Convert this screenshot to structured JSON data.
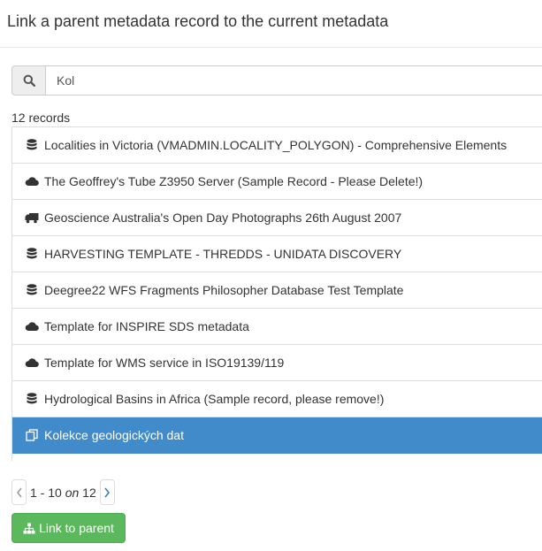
{
  "dialog": {
    "title": "Link a parent metadata record to the current metadata"
  },
  "search": {
    "value": "Kol",
    "icon": "search-icon"
  },
  "results": {
    "count_label": "12 records",
    "items": [
      {
        "label": "Localities in Victoria (VMADMIN.LOCALITY_POLYGON) - Comprehensive Elements",
        "icon": "database-icon"
      },
      {
        "label": "The Geoffrey's Tube Z3950 Server (Sample Record - Please Delete!)",
        "icon": "cloud-icon"
      },
      {
        "label": "Geoscience Australia's Open Day Photographs 26th August 2007",
        "icon": "truck-icon"
      },
      {
        "label": "HARVESTING TEMPLATE - THREDDS - UNIDATA DISCOVERY",
        "icon": "database-icon"
      },
      {
        "label": "Deegree22 WFS Fragments Philosopher Database Test Template",
        "icon": "database-icon"
      },
      {
        "label": "Template for INSPIRE SDS metadata",
        "icon": "cloud-icon"
      },
      {
        "label": "Template for WMS service in ISO19139/119",
        "icon": "cloud-icon"
      },
      {
        "label": "Hydrological Basins in Africa (Sample record, please remove!)",
        "icon": "database-icon"
      },
      {
        "label": "Kolekce geologických dat",
        "icon": "copy-icon",
        "selected": true
      }
    ]
  },
  "pagination": {
    "range": "1 - 10",
    "on": "on",
    "total": "12"
  },
  "actions": {
    "link_label": "Link to parent",
    "link_icon": "sitemap-icon"
  },
  "colors": {
    "selected_bg": "#428bca",
    "button_green": "#5cb85c"
  }
}
